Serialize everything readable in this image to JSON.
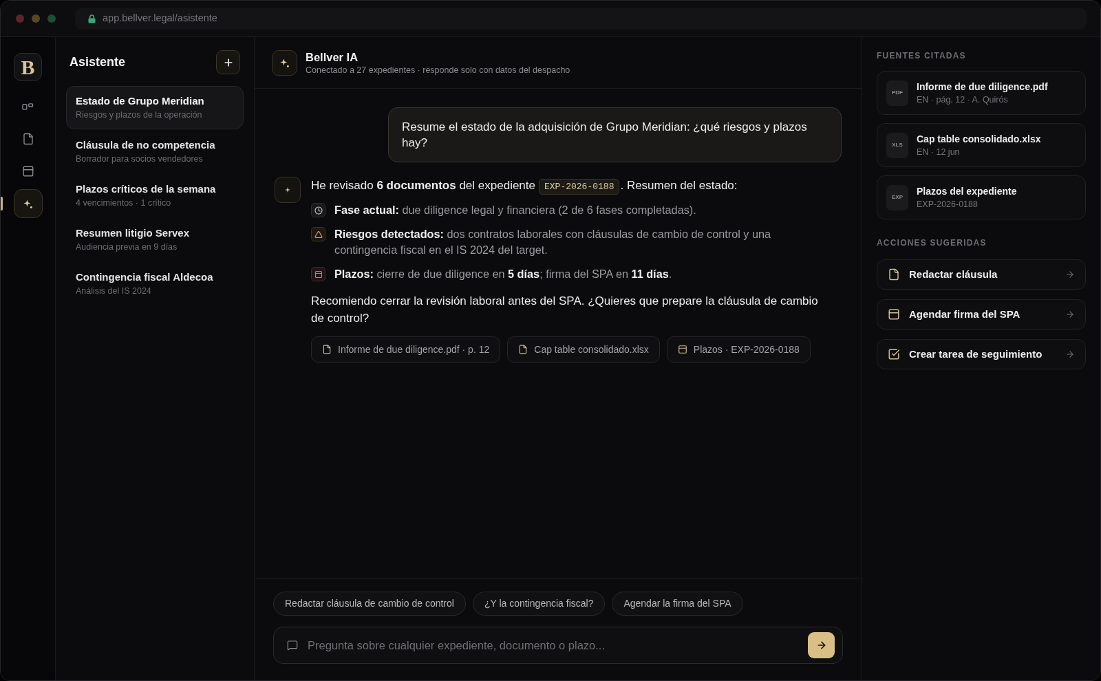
{
  "browser": {
    "url": "app.bellver.legal/asistente"
  },
  "rail": {
    "logo": "B",
    "items": [
      {
        "kind": "dashboard",
        "selected": false
      },
      {
        "kind": "documents",
        "selected": false
      },
      {
        "kind": "calendar",
        "selected": false
      },
      {
        "kind": "assistant",
        "selected": true
      }
    ]
  },
  "sidebar": {
    "title": "Asistente",
    "conversations": [
      {
        "title": "Estado de Grupo Meridian",
        "subtitle": "Riesgos y plazos de la operación",
        "selected": true
      },
      {
        "title": "Cláusula de no competencia",
        "subtitle": "Borrador para socios vendedores",
        "selected": false
      },
      {
        "title": "Plazos críticos de la semana",
        "subtitle": "4 vencimientos · 1 crítico",
        "selected": false
      },
      {
        "title": "Resumen litigio Servex",
        "subtitle": "Audiencia previa en 9 días",
        "selected": false
      },
      {
        "title": "Contingencia fiscal Aldecoa",
        "subtitle": "Análisis del IS 2024",
        "selected": false
      }
    ]
  },
  "chat": {
    "title": "Bellver IA",
    "subtitle": "Conectado a 27 expedientes · responde solo con datos del despacho",
    "messages": [
      {
        "kind": "user",
        "text": "Resume el estado de la adquisición de Grupo Meridian: ¿qué riesgos y plazos hay?"
      },
      {
        "kind": "assistant",
        "lead_before": "He revisado **6 documentos** del expediente",
        "lead_code": "EXP-2026-0188",
        "lead_after": ". Resumen del estado:",
        "points": [
          {
            "kind": "phase",
            "text": "**Fase actual:** due diligence legal y financiera (2 de 6 fases completadas)."
          },
          {
            "kind": "risk",
            "text": "**Riesgos detectados:** dos contratos laborales con cláusulas de cambio de control y una contingencia fiscal en el IS 2024 del target."
          },
          {
            "kind": "deadline",
            "text": "**Plazos:** cierre de due diligence en **5 días**; firma del SPA en **11 días**."
          }
        ],
        "closing": "Recomiendo cerrar la revisión laboral antes del SPA. ¿Quieres que prepare la cláusula de cambio de control?",
        "sources": [
          {
            "kind": "document",
            "label": "Informe de due diligence.pdf · p. 12"
          },
          {
            "kind": "document",
            "label": "Cap table consolidado.xlsx"
          },
          {
            "kind": "deadlines",
            "label": "Plazos · EXP-2026-0188"
          }
        ]
      }
    ],
    "suggestions": [
      "Redactar cláusula de cambio de control",
      "¿Y la contingencia fiscal?",
      "Agendar la firma del SPA"
    ],
    "composer": {
      "placeholder": "Pregunta sobre cualquier expediente, documento o plazo..."
    }
  },
  "sources_panel": {
    "title": "FUENTES CITADAS",
    "items": [
      {
        "badge": "PDF",
        "title": "Informe de due diligence.pdf",
        "meta": "EN · pág. 12 · A. Quirós"
      },
      {
        "badge": "XLS",
        "title": "Cap table consolidado.xlsx",
        "meta": "EN · 12 jun"
      },
      {
        "badge": "EXP",
        "title": "Plazos del expediente",
        "meta": "EXP-2026-0188"
      }
    ]
  },
  "actions_panel": {
    "title": "ACCIONES SUGERIDAS",
    "items": [
      {
        "kind": "draft",
        "label": "Redactar cláusula"
      },
      {
        "kind": "schedule",
        "label": "Agendar firma del SPA"
      },
      {
        "kind": "task",
        "label": "Crear tarea de seguimiento"
      }
    ]
  }
}
